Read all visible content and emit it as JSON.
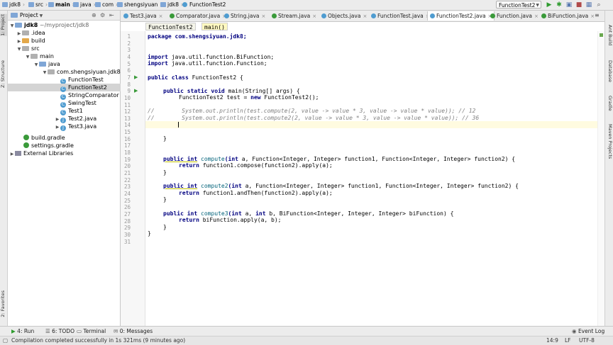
{
  "breadcrumbs": [
    "jdk8",
    "src",
    "main",
    "java",
    "com",
    "shengsiyuan",
    "jdk8",
    "FunctionTest2"
  ],
  "run_config": "FunctionTest2",
  "project_panel": {
    "header": "Project",
    "items": [
      {
        "label": "jdk8",
        "extra": "~/myproject/jdk8"
      },
      {
        "label": ".idea"
      },
      {
        "label": "build"
      },
      {
        "label": "src"
      },
      {
        "label": "main"
      },
      {
        "label": "java"
      },
      {
        "label": "com.shengsiyuan.jdk8"
      },
      {
        "label": "FunctionTest"
      },
      {
        "label": "FunctionTest2"
      },
      {
        "label": "StringComparator"
      },
      {
        "label": "SwingTest"
      },
      {
        "label": "Test1"
      },
      {
        "label": "Test2.java"
      },
      {
        "label": "Test3.java"
      },
      {
        "label": "build.gradle"
      },
      {
        "label": "settings.gradle"
      },
      {
        "label": "External Libraries"
      }
    ]
  },
  "left_strip": {
    "project": "1: Project",
    "structure": "Z: Structure",
    "favorites": "2: Favorites"
  },
  "right_strip": {
    "ant": "Ant Build",
    "database": "Database",
    "gradle": "Gradle",
    "maven": "Maven Projects"
  },
  "tabs": [
    {
      "label": "Test3.java"
    },
    {
      "label": "Comparator.java"
    },
    {
      "label": "String.java"
    },
    {
      "label": "Stream.java"
    },
    {
      "label": "Objects.java"
    },
    {
      "label": "FunctionTest.java"
    },
    {
      "label": "FunctionTest2.java"
    },
    {
      "label": "Function.java"
    },
    {
      "label": "BiFunction.java"
    }
  ],
  "editor_crumbs": [
    "FunctionTest2",
    "main()"
  ],
  "code": {
    "l1": "package com.shengsiyuan.jdk8;",
    "l4a": "import",
    "l4b": " java.util.function.BiFunction;",
    "l5a": "import",
    "l5b": " java.util.function.Function;",
    "l7a": "public class",
    "l7b": " FunctionTest2 {",
    "l9a": "public static void",
    "l9b": " main(String[] args) {",
    "l10a": "FunctionTest2 test = ",
    "l10b": "new",
    "l10c": " FunctionTest2();",
    "l12": "//        System.out.println(test.compute(2, value -> value * 3, value -> value * value)); // 12",
    "l13": "//        System.out.println(test.compute2(2, value -> value * 3, value -> value * value)); // 36",
    "l16": "}",
    "l19a": "public int",
    "l19b": "compute",
    "l19c": "(int",
    "l19d": " a, Function<Integer, Integer> function1, Function<Integer, Integer> function2) {",
    "l20a": "return",
    "l20b": " function1.compose(function2).apply(a);",
    "l21": "}",
    "l23a": "public int",
    "l23b": "compute2",
    "l23c": "(int",
    "l23d": " a, Function<Integer, Integer> function1, Function<Integer, Integer> function2) {",
    "l24a": "return",
    "l24b": " function1.andThen(function2).apply(a);",
    "l25": "}",
    "l27a": "public int",
    "l27b": "compute3",
    "l27c": "(int",
    "l27d": " a, ",
    "l27e": "int",
    "l27f": " b, BiFunction<Integer, Integer, Integer> biFunction) {",
    "l28a": "return",
    "l28b": " biFunction.apply(a, b);",
    "l29": "}",
    "l30": "}"
  },
  "line_numbers": [
    "1",
    "2",
    "3",
    "4",
    "5",
    "6",
    "7",
    "8",
    "9",
    "10",
    "11",
    "12",
    "13",
    "14",
    "15",
    "16",
    "17",
    "18",
    "19",
    "20",
    "21",
    "22",
    "23",
    "24",
    "25",
    "26",
    "27",
    "28",
    "29",
    "30",
    "31"
  ],
  "bottom_tools": {
    "run": "4: Run",
    "todo": "6: TODO",
    "terminal": "Terminal",
    "messages": "0: Messages",
    "event_log": "Event Log"
  },
  "status": {
    "message": "Compilation completed successfully in 1s 321ms (9 minutes ago)",
    "position": "14:9",
    "line_sep": "LF",
    "encoding": "UTF-8"
  }
}
